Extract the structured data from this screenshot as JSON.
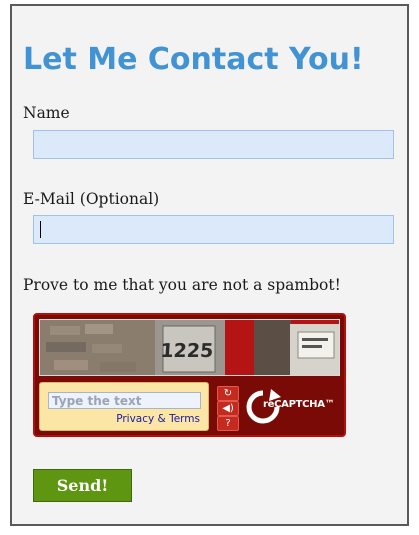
{
  "form": {
    "title": "Let Me Contact You!",
    "name_label": "Name",
    "name_value": "",
    "email_label": "E-Mail (Optional)",
    "email_value": "",
    "captcha_prompt": "Prove to me that you are not a spambot!",
    "send_label": "Send!"
  },
  "captcha": {
    "image_text": "1225",
    "input_placeholder": "Type the text",
    "terms_link": "Privacy & Terms",
    "brand": "reCAPTCHA™",
    "buttons": [
      "refresh-icon",
      "audio-icon",
      "help-icon"
    ],
    "brand_color": "#7a0a06"
  },
  "colors": {
    "title": "#4193d3",
    "field_bg": "#dce9fb",
    "send_bg": "#5e9612",
    "panel_bg": "#f3f3f3"
  }
}
